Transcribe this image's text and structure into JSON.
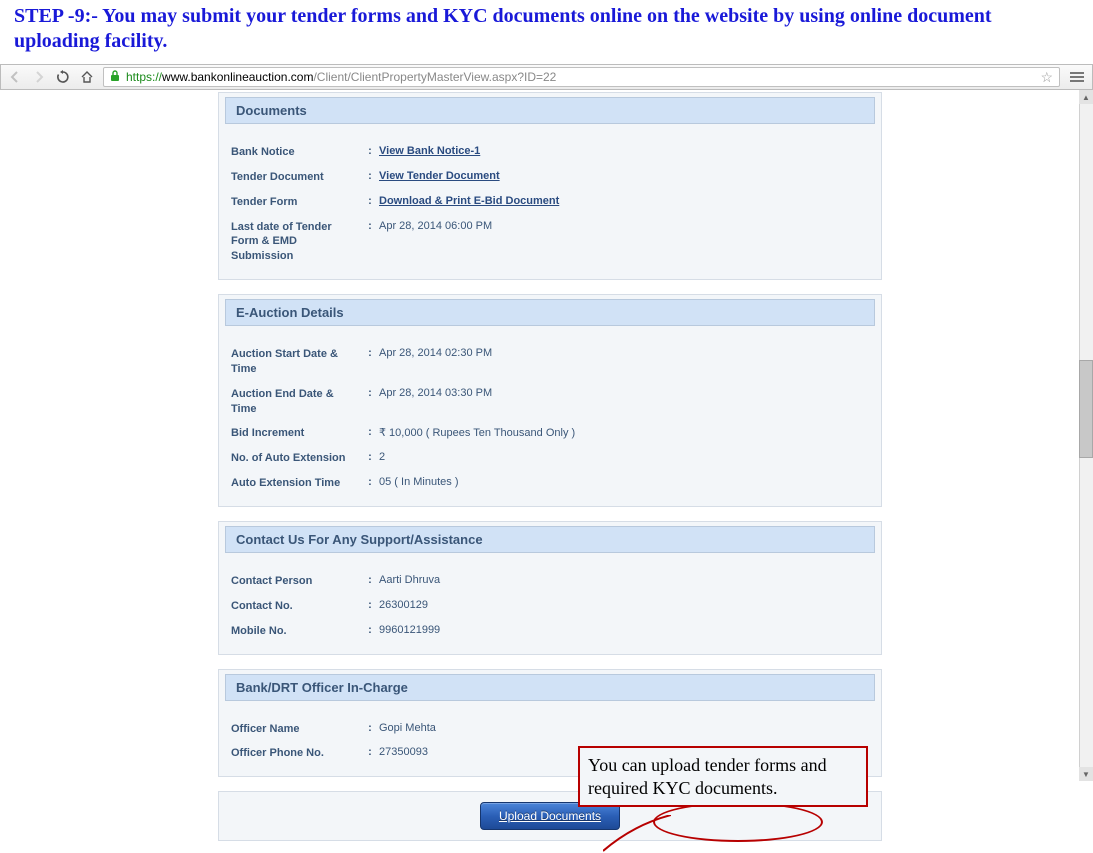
{
  "instruction": "STEP -9:- You may submit your tender forms and KYC documents online on the website by using online document uploading facility.",
  "browser": {
    "url_proto": "https://",
    "url_host": "www.bankonlineauction.com",
    "url_path": "/Client/ClientPropertyMasterView.aspx?ID=22"
  },
  "documents": {
    "header": "Documents",
    "rows": [
      {
        "label": "Bank Notice",
        "link": "View Bank Notice-1"
      },
      {
        "label": "Tender Document",
        "link": "View Tender Document"
      },
      {
        "label": "Tender Form",
        "link": "Download & Print E-Bid Document"
      },
      {
        "label": "Last date of Tender Form & EMD Submission",
        "value": "Apr 28, 2014    06:00 PM"
      }
    ]
  },
  "eauction": {
    "header": "E-Auction Details",
    "rows": [
      {
        "label": "Auction Start Date & Time",
        "value": "Apr 28, 2014   02:30 PM"
      },
      {
        "label": "Auction End Date & Time",
        "value": "Apr 28, 2014   03:30 PM"
      },
      {
        "label": "Bid Increment",
        "value": "₹  10,000   ( Rupees Ten Thousand Only )"
      },
      {
        "label": "No. of Auto Extension",
        "value": "2"
      },
      {
        "label": "Auto Extension Time",
        "value": "05 ( In Minutes )"
      }
    ]
  },
  "contact": {
    "header": "Contact Us For Any Support/Assistance",
    "rows": [
      {
        "label": "Contact Person",
        "value": "Aarti Dhruva"
      },
      {
        "label": "Contact No.",
        "value": "26300129"
      },
      {
        "label": "Mobile No.",
        "value": "9960121999"
      }
    ]
  },
  "officer": {
    "header": "Bank/DRT Officer In-Charge",
    "rows": [
      {
        "label": "Officer Name",
        "value": "Gopi Mehta"
      },
      {
        "label": "Officer Phone No.",
        "value": "27350093"
      }
    ]
  },
  "upload_button": "Upload Documents",
  "annotation_text": "You can upload tender forms and required KYC documents."
}
